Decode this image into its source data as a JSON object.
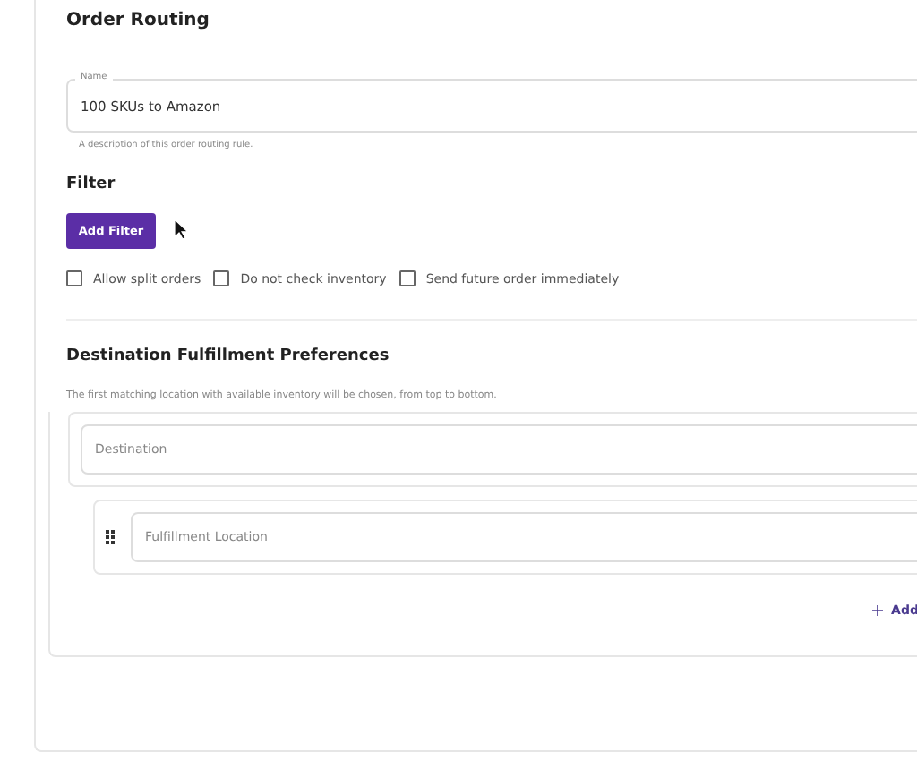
{
  "title": "Order Routing",
  "name_field": {
    "label": "Name",
    "value": "100 SKUs to Amazon",
    "helper": "A description of this order routing rule."
  },
  "filter": {
    "heading": "Filter",
    "button": "Add Filter"
  },
  "options": [
    {
      "label": "Allow split orders",
      "checked": false
    },
    {
      "label": "Do not check inventory",
      "checked": false
    },
    {
      "label": "Send future order immediately",
      "checked": false
    }
  ],
  "preferences": {
    "heading": "Destination Fulfillment Preferences",
    "description": "The first matching location with available inventory will be chosen, from top to bottom.",
    "destination": {
      "placeholder": "Destination"
    },
    "locations": [
      {
        "placeholder": "Fulfillment Location"
      }
    ],
    "add_link": "Add"
  }
}
